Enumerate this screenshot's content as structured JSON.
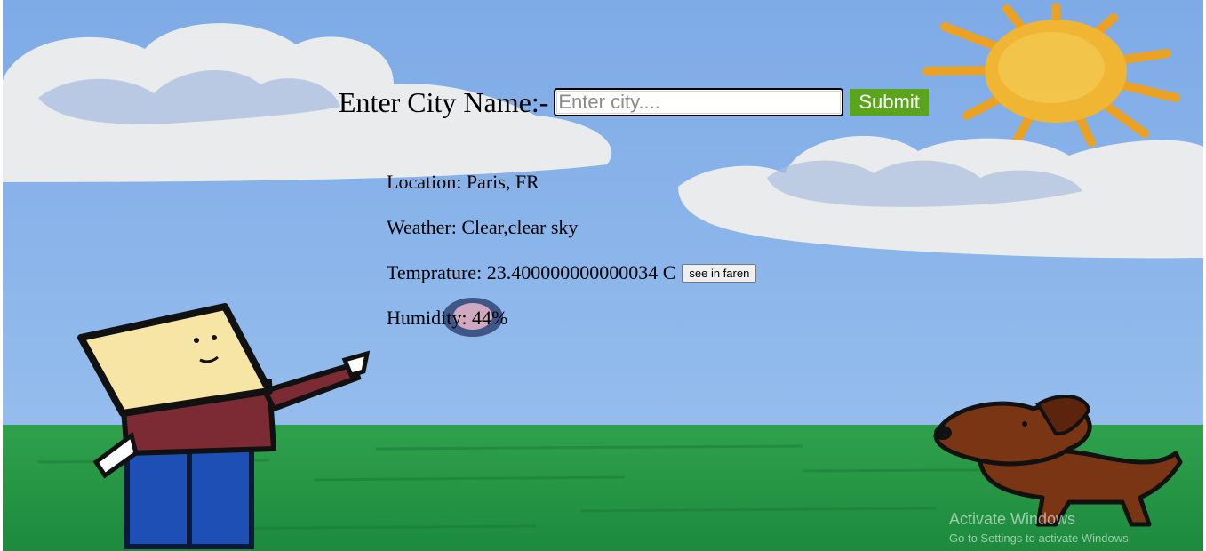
{
  "form": {
    "label": "Enter City Name:-",
    "city_placeholder": "Enter city....",
    "city_value": "",
    "submit_label": "Submit"
  },
  "weather": {
    "location_label": "Location:",
    "location_value": "Paris, FR",
    "weather_label": "Weather:",
    "weather_value": "Clear,clear sky",
    "temperature_label": "Temprature:",
    "temperature_value": "23.400000000000034",
    "temperature_unit": "C",
    "faren_button_label": "see in faren",
    "humidity_label": "Humidity:",
    "humidity_value": "44",
    "humidity_unit": "%"
  },
  "watermark": {
    "title": "Activate Windows",
    "subtitle": "Go to Settings to activate Windows."
  },
  "colors": {
    "sky": "#86b2e8",
    "grass": "#2a9a4a",
    "submit_bg": "#5ba51d",
    "sun": "#f7b52a"
  }
}
